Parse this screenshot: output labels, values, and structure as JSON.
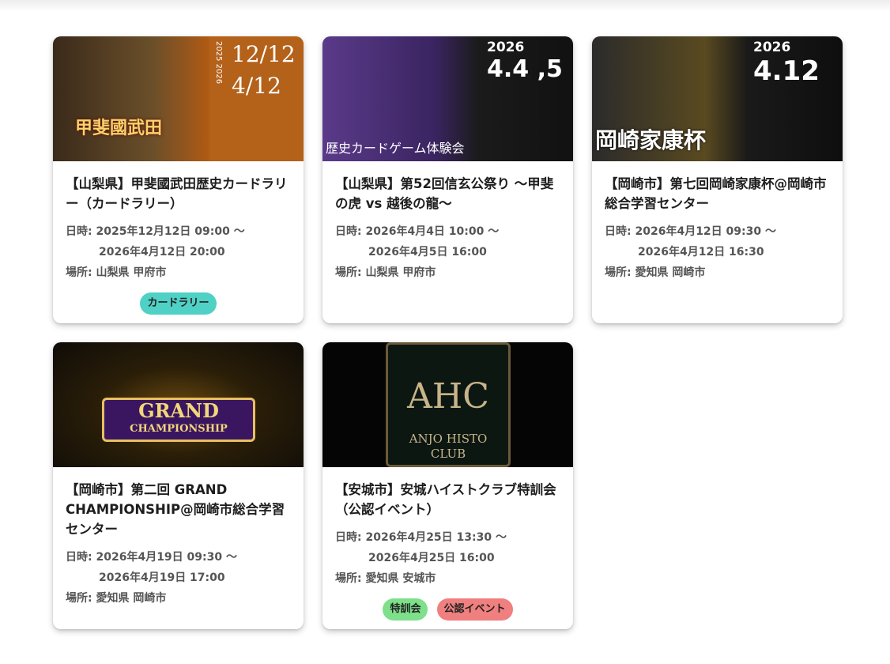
{
  "events": [
    {
      "thumb": {
        "dates": [
          "12/12",
          "4/12"
        ],
        "years": "2025 2026",
        "logo_text": "甲斐國武田"
      },
      "title": "【山梨県】甲斐國武田歴史カードラリー（カードラリー）",
      "datetime_label": "日時:",
      "start": "2025年12月12日 09:00 〜",
      "end": "2026年4月12日 20:00",
      "place_label": "場所:",
      "place": "山梨県 甲府市",
      "tags": [
        {
          "label": "カードラリー",
          "color": "#4fd1c5"
        }
      ]
    },
    {
      "thumb": {
        "year": "2026",
        "date": "4.4 ,5",
        "caption": "歴史カードゲーム体験会"
      },
      "title": "【山梨県】第52回信玄公祭り 〜甲斐の虎 vs 越後の龍〜",
      "datetime_label": "日時:",
      "start": "2026年4月4日 10:00 〜",
      "end": "2026年4月5日 16:00",
      "place_label": "場所:",
      "place": "山梨県 甲府市",
      "tags": []
    },
    {
      "thumb": {
        "year": "2026",
        "date": "4.12",
        "caption": "岡崎家康杯"
      },
      "title": "【岡崎市】第七回岡崎家康杯@岡崎市総合学習センター",
      "datetime_label": "日時:",
      "start": "2026年4月12日 09:30 〜",
      "end": "2026年4月12日 16:30",
      "place_label": "場所:",
      "place": "愛知県 岡崎市",
      "tags": []
    },
    {
      "thumb": {
        "line1": "GRAND",
        "line2": "CHAMPIONSHIP"
      },
      "title": "【岡崎市】第二回 GRAND CHAMPIONSHIP@岡崎市総合学習センター",
      "datetime_label": "日時:",
      "start": "2026年4月19日 09:30 〜",
      "end": "2026年4月19日 17:00",
      "place_label": "場所:",
      "place": "愛知県 岡崎市",
      "tags": []
    },
    {
      "thumb": {
        "big": "AHC",
        "line1": "ANJO HISTO",
        "line2": "CLUB"
      },
      "title": "【安城市】安城ハイストクラブ特訓会（公認イベント）",
      "datetime_label": "日時:",
      "start": "2026年4月25日 13:30 〜",
      "end": "2026年4月25日 16:00",
      "place_label": "場所:",
      "place": "愛知県 安城市",
      "tags": [
        {
          "label": "特訓会",
          "color": "#7ee08a"
        },
        {
          "label": "公認イベント",
          "color": "#f07f7f"
        }
      ]
    }
  ]
}
